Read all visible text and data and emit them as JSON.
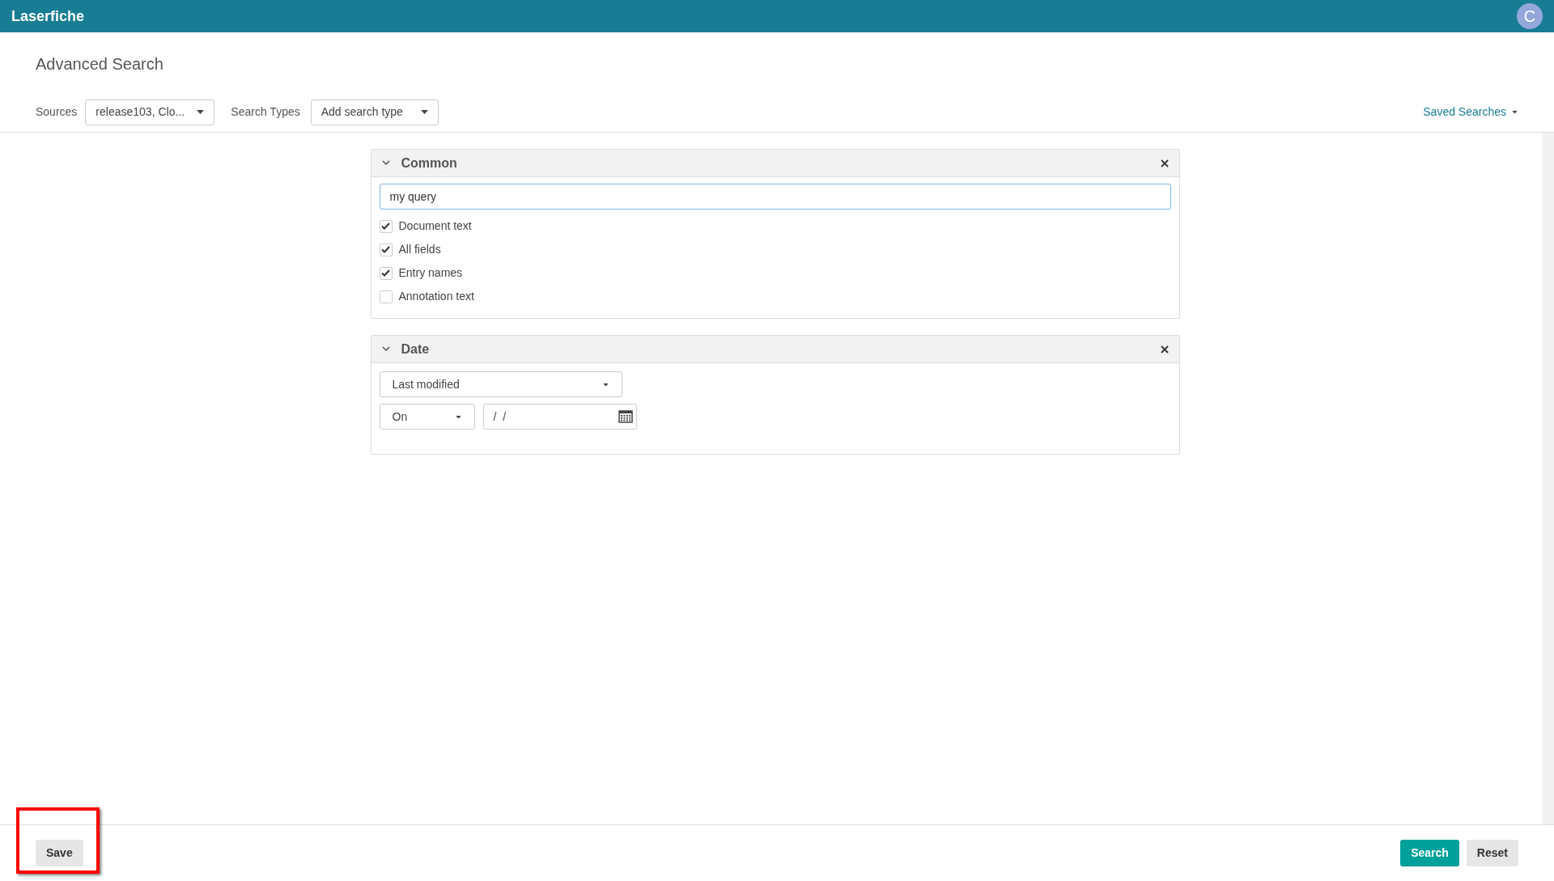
{
  "header": {
    "logo": "Laserfiche",
    "avatar": "C"
  },
  "page_title": "Advanced Search",
  "toolbar": {
    "sources_label": "Sources",
    "sources_value": "release103, Clo...",
    "search_types_label": "Search Types",
    "search_types_value": "Add search type",
    "saved_searches": "Saved Searches"
  },
  "panels": [
    {
      "kind": "common",
      "title": "Common",
      "expanded": true,
      "query": "my query",
      "options": [
        {
          "label": "Document text",
          "checked": true
        },
        {
          "label": "All fields",
          "checked": true
        },
        {
          "label": "Entry names",
          "checked": true
        },
        {
          "label": "Annotation text",
          "checked": false
        }
      ]
    },
    {
      "kind": "date",
      "title": "Date",
      "expanded": true,
      "field": "Last modified",
      "operator": "On",
      "date": "/  /"
    }
  ],
  "footer": {
    "save": "Save",
    "save_highlighted": true,
    "search": "Search",
    "reset": "Reset"
  }
}
